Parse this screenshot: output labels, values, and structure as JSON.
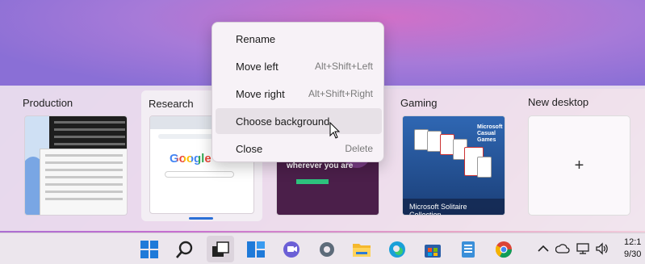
{
  "menu": {
    "items": [
      {
        "label": "Rename",
        "shortcut": ""
      },
      {
        "label": "Move left",
        "shortcut": "Alt+Shift+Left"
      },
      {
        "label": "Move right",
        "shortcut": "Alt+Shift+Right"
      },
      {
        "label": "Choose background",
        "shortcut": ""
      },
      {
        "label": "Close",
        "shortcut": "Delete"
      }
    ]
  },
  "desktops": [
    {
      "label": "Production"
    },
    {
      "label": "Research",
      "active": true
    },
    {
      "label": "Gaming"
    },
    {
      "label": "New desktop"
    }
  ],
  "thumbs": {
    "research_logo": "Google",
    "teams_text": "team together wherever you are",
    "gaming_brand": "Microsoft Casual Games",
    "gaming_caption": "Microsoft Solitaire Collection"
  },
  "new_desktop_symbol": "+",
  "taskbar": {
    "icons": [
      "windows-start-icon",
      "search-icon",
      "task-view-icon",
      "widgets-icon",
      "chat-icon",
      "settings-icon",
      "file-explorer-icon",
      "edge-icon",
      "store-icon",
      "notepad-icon",
      "chrome-icon"
    ],
    "tray": [
      "chevron-up-icon",
      "cloud-icon",
      "network-icon",
      "volume-icon"
    ],
    "clock_time": "12:1",
    "clock_date": "9/30"
  },
  "colors": {
    "accent": "#2b6fd6"
  }
}
